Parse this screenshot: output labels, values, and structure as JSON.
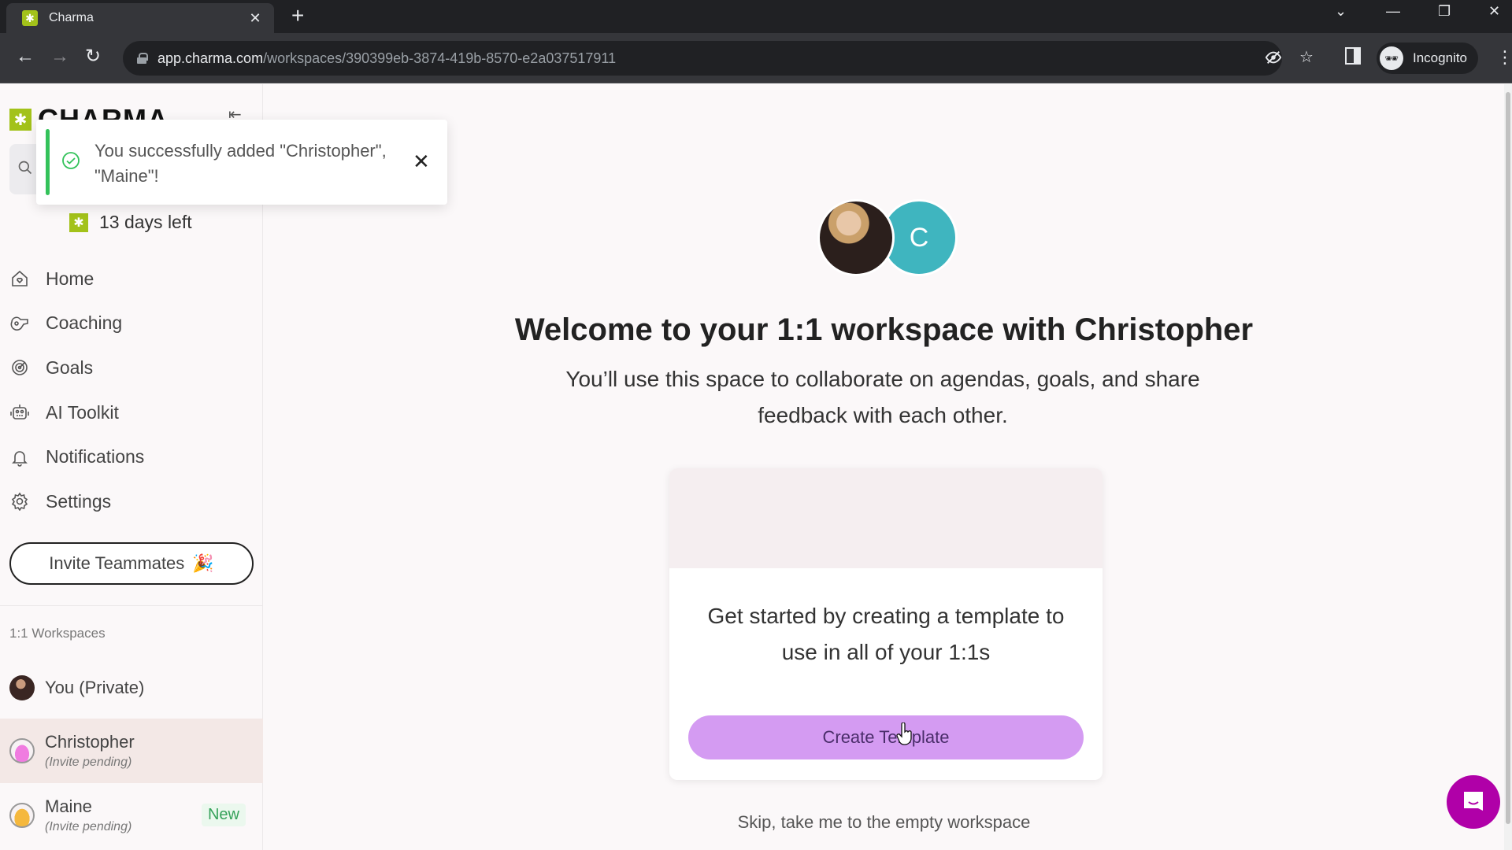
{
  "browser": {
    "tab_title": "Charma",
    "tab_favicon": "charma-logo-icon",
    "new_tab": "+",
    "url_host": "app.charma.com",
    "url_path": "/workspaces/390399eb-3874-419b-8570-e2a037517911",
    "incognito_label": "Incognito",
    "icons": [
      "back-icon",
      "forward-icon",
      "reload-icon",
      "lock-icon",
      "eye-off-icon",
      "star-icon",
      "side-panel-icon",
      "incognito-icon",
      "kebab-menu-icon",
      "tab-search-icon",
      "minimize-icon",
      "restore-icon",
      "close-icon"
    ]
  },
  "sidebar": {
    "logo_text": "CHARMA",
    "trial_text": "13 days left",
    "nav": [
      {
        "label": "Home",
        "icon": "home-heart-icon"
      },
      {
        "label": "Coaching",
        "icon": "whistle-icon"
      },
      {
        "label": "Goals",
        "icon": "target-icon"
      },
      {
        "label": "AI Toolkit",
        "icon": "robot-icon"
      },
      {
        "label": "Notifications",
        "icon": "bell-icon"
      },
      {
        "label": "Settings",
        "icon": "gear-icon"
      }
    ],
    "invite_label": "Invite Teammates",
    "invite_emoji": "🎉",
    "section_label": "1:1 Workspaces",
    "workspaces": [
      {
        "name": "You (Private)",
        "sub": "",
        "badge": "",
        "active": false
      },
      {
        "name": "Christopher",
        "sub": "(Invite pending)",
        "badge": "",
        "active": true
      },
      {
        "name": "Maine",
        "sub": "(Invite pending)",
        "badge": "New",
        "active": false
      }
    ]
  },
  "toast": {
    "message": "You successfully added \"Christopher\", \"Maine\"!",
    "status_color": "#33c25a"
  },
  "main": {
    "avatar_initial": "C",
    "title": "Welcome to your 1:1 workspace with Christopher",
    "subtitle": "You’ll use this space to collaborate on agendas, goals, and share feedback with each other.",
    "card_text": "Get started by creating a template to use in all of your 1:1s",
    "create_button": "Create Template",
    "skip_link": "Skip, take me to the empty workspace"
  },
  "colors": {
    "brand_green": "#a3c21a",
    "primary_button": "#d49bf2",
    "avatar_teal": "#3fb5bf",
    "chat_launcher": "#b000a8"
  }
}
